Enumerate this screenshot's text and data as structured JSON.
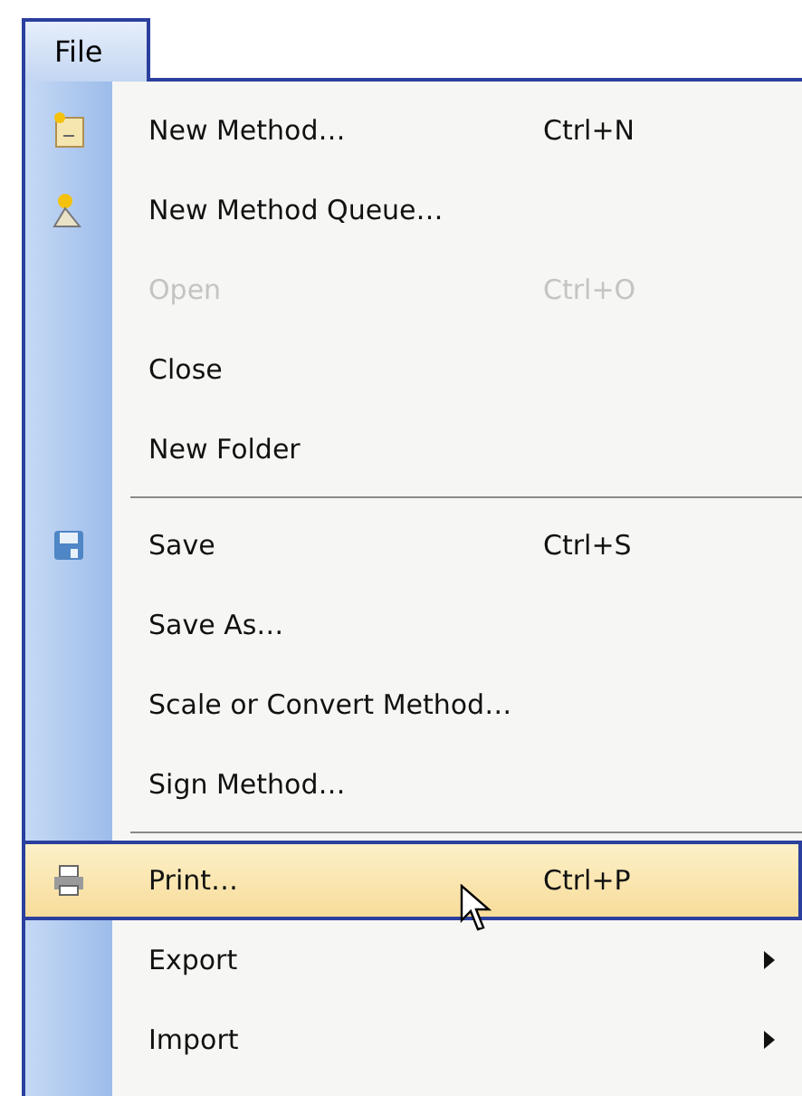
{
  "menu_bar": {
    "label": "File",
    "selected": true
  },
  "items": [
    {
      "kind": "item",
      "label": "New Method…",
      "shortcut": "Ctrl+N",
      "disabled": false,
      "selected": false,
      "submenu": false
    },
    {
      "kind": "item",
      "label": "New Method Queue…",
      "disabled": false,
      "selected": false,
      "submenu": false
    },
    {
      "kind": "item",
      "label": "Open",
      "shortcut": "Ctrl+O",
      "disabled": true,
      "selected": false,
      "submenu": false
    },
    {
      "kind": "item",
      "label": "Close",
      "disabled": false,
      "selected": false,
      "submenu": false
    },
    {
      "kind": "item",
      "label": "New Folder",
      "disabled": false,
      "selected": false,
      "submenu": false
    },
    {
      "kind": "separator"
    },
    {
      "kind": "item",
      "label": "Save",
      "shortcut": "Ctrl+S",
      "disabled": false,
      "selected": false,
      "submenu": false
    },
    {
      "kind": "item",
      "label": "Save As…",
      "disabled": false,
      "selected": false,
      "submenu": false
    },
    {
      "kind": "item",
      "label": "Scale or Convert Method…",
      "disabled": false,
      "selected": false,
      "submenu": false
    },
    {
      "kind": "item",
      "label": "Sign Method…",
      "disabled": false,
      "selected": false,
      "submenu": false
    },
    {
      "kind": "separator"
    },
    {
      "kind": "item",
      "label": "Print…",
      "shortcut": "Ctrl+P",
      "disabled": false,
      "selected": true,
      "submenu": false
    },
    {
      "kind": "item",
      "label": "Export",
      "disabled": false,
      "selected": false,
      "submenu": true
    },
    {
      "kind": "item",
      "label": "Import",
      "disabled": false,
      "selected": false,
      "submenu": true
    }
  ]
}
